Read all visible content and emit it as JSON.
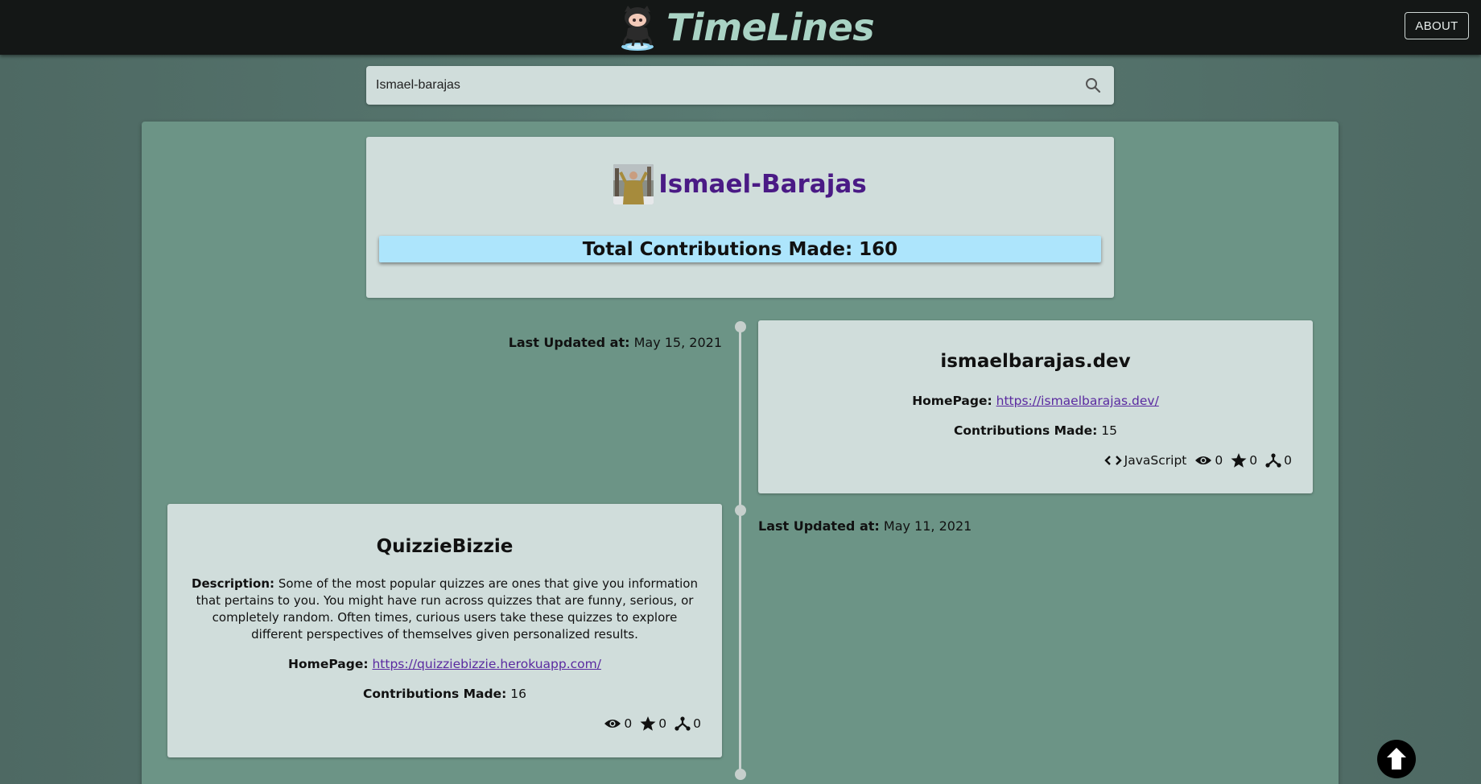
{
  "header": {
    "app_title": "TimeLines",
    "about_label": "ABOUT",
    "logo_icon": "octocat-logo-icon"
  },
  "search": {
    "value": "Ismael-barajas",
    "icon": "search-icon"
  },
  "profile": {
    "username": "Ismael-Barajas",
    "total_label": "Total Contributions Made: 160"
  },
  "timeline": [
    {
      "updated_label": "Last Updated at:",
      "updated_value": "May 15, 2021",
      "title": "ismaelbarajas.dev",
      "homepage_label": "HomePage:",
      "homepage_url": "https://ismaelbarajas.dev/",
      "contrib_label": "Contributions Made:",
      "contrib_value": "15",
      "language": "JavaScript",
      "watchers": "0",
      "stars": "0",
      "forks": "0"
    },
    {
      "updated_label": "Last Updated at:",
      "updated_value": "May 11, 2021",
      "title": "QuizzieBizzie",
      "description_label": "Description:",
      "description": "Some of the most popular quizzes are ones that give you information that pertains to you. You might have run across quizzes that are funny, serious, or completely random. Often times, curious users take these quizzes to explore different perspectives of themselves given personalized results.",
      "homepage_label": "HomePage:",
      "homepage_url": "https://quizziebizzie.herokuapp.com/",
      "contrib_label": "Contributions Made:",
      "contrib_value": "16",
      "watchers": "0",
      "stars": "0",
      "forks": "0"
    }
  ],
  "colors": {
    "header_bg": "#141716",
    "brand": "#a9d3c4",
    "panel_bg": "#6c9486",
    "card_bg": "#d0dddb",
    "username": "#4a1a85",
    "total_bg": "#ade5fc"
  }
}
